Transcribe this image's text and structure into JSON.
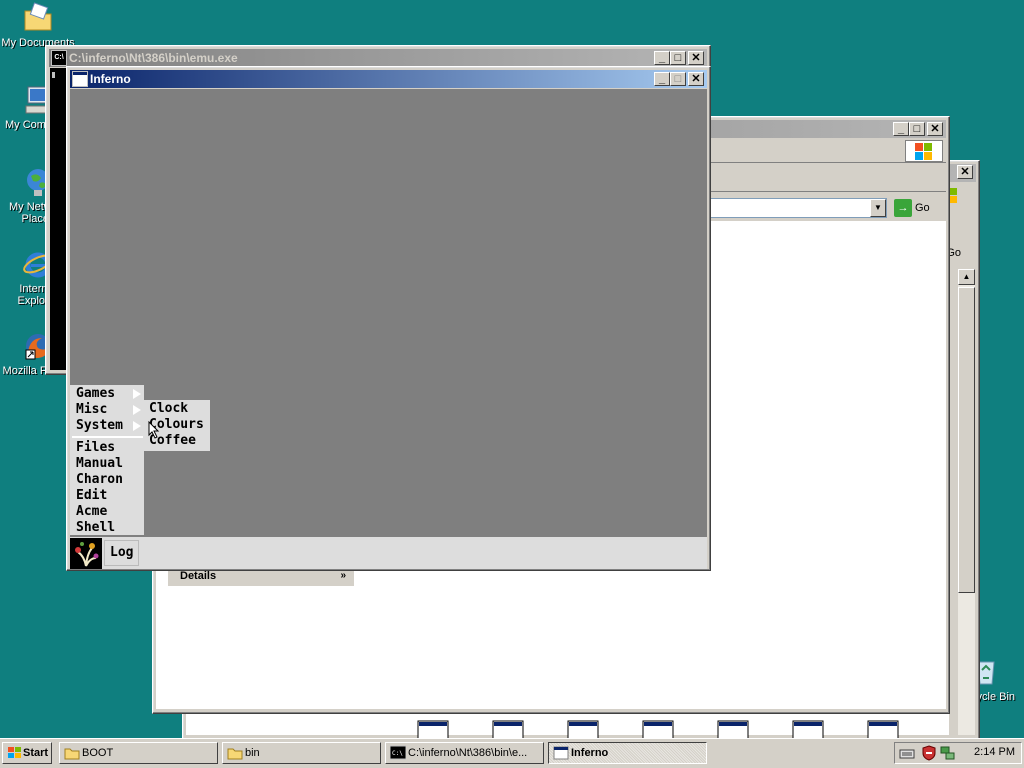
{
  "desktop": {
    "icons": [
      {
        "label": "My Documents"
      },
      {
        "label": "My Computer"
      },
      {
        "label": "My Network Places"
      },
      {
        "label": "Internet Explorer"
      },
      {
        "label": "Mozilla Firefox"
      },
      {
        "label": "Recycle Bin"
      }
    ]
  },
  "console_window": {
    "title": "C:\\inferno\\Nt\\386\\bin\\emu.exe"
  },
  "inferno_window": {
    "title": "Inferno",
    "menu": {
      "items": [
        "Games",
        "Misc",
        "System",
        "Files",
        "Manual",
        "Charon",
        "Edit",
        "Acme",
        "Shell"
      ],
      "submenu": [
        "Clock",
        "Colours",
        "Coffee"
      ]
    },
    "taskbar_button": "Log"
  },
  "explorer_window": {
    "go_label": "Go",
    "details_label": "Details"
  },
  "explorer_window2": {
    "go_label": "Go"
  },
  "taskbar": {
    "start_label": "Start",
    "buttons": [
      "BOOT",
      "bin",
      "C:\\inferno\\Nt\\386\\bin\\e...",
      "Inferno"
    ],
    "clock": "2:14 PM"
  }
}
